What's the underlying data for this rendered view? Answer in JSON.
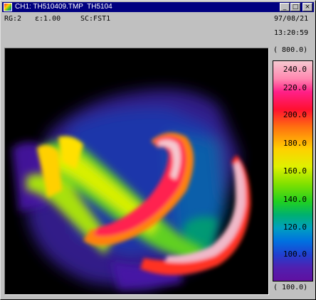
{
  "window": {
    "title": "CH1: TH510409.TMP  TH5104",
    "buttons": {
      "minimize": "_",
      "maximize": "□",
      "close": "×"
    }
  },
  "info": {
    "range": "RG:2",
    "emissivity": "ε:1.00",
    "scale": "SC:FST1",
    "date": "97/08/21",
    "time": "13:20:59"
  },
  "colorbar": {
    "top_value": "( 800.0)",
    "bottom_value": "( 100.0)",
    "labels": [
      "240.0",
      "220.0",
      "200.0",
      "180.0",
      "160.0",
      "140.0",
      "120.0",
      "100.0"
    ]
  }
}
